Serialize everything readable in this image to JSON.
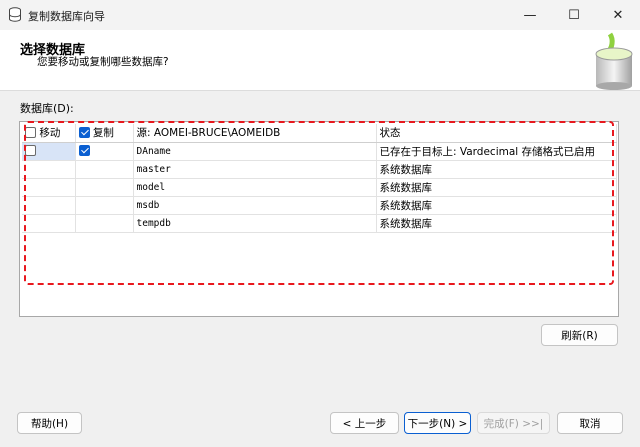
{
  "window": {
    "title": "复制数据库向导",
    "minimize_glyph": "—",
    "maximize_glyph": "☐",
    "close_glyph": "✕"
  },
  "header": {
    "title": "选择数据库",
    "subtitle": "您要移动或复制哪些数据库?"
  },
  "databases_label": "数据库(D):",
  "grid": {
    "columns": {
      "move": "移动",
      "copy": "复制",
      "source": "源: AOMEI-BRUCE\\AOMEIDB",
      "status": "状态"
    },
    "header_checks": {
      "move": false,
      "copy": true
    },
    "rows": [
      {
        "move": false,
        "copy": true,
        "name": "DAname",
        "status": "已存在于目标上: Vardecimal 存储格式已启用"
      },
      {
        "move": null,
        "copy": null,
        "name": "master",
        "status": "系统数据库"
      },
      {
        "move": null,
        "copy": null,
        "name": "model",
        "status": "系统数据库"
      },
      {
        "move": null,
        "copy": null,
        "name": "msdb",
        "status": "系统数据库"
      },
      {
        "move": null,
        "copy": null,
        "name": "tempdb",
        "status": "系统数据库"
      }
    ]
  },
  "buttons": {
    "refresh": "刷新(R)",
    "help": "帮助(H)",
    "back": "< 上一步",
    "next": "下一步(N) >",
    "finish": "完成(F) >>|",
    "cancel": "取消"
  },
  "colors": {
    "annotation": "#e8181e",
    "accent": "#0a5fd1"
  }
}
